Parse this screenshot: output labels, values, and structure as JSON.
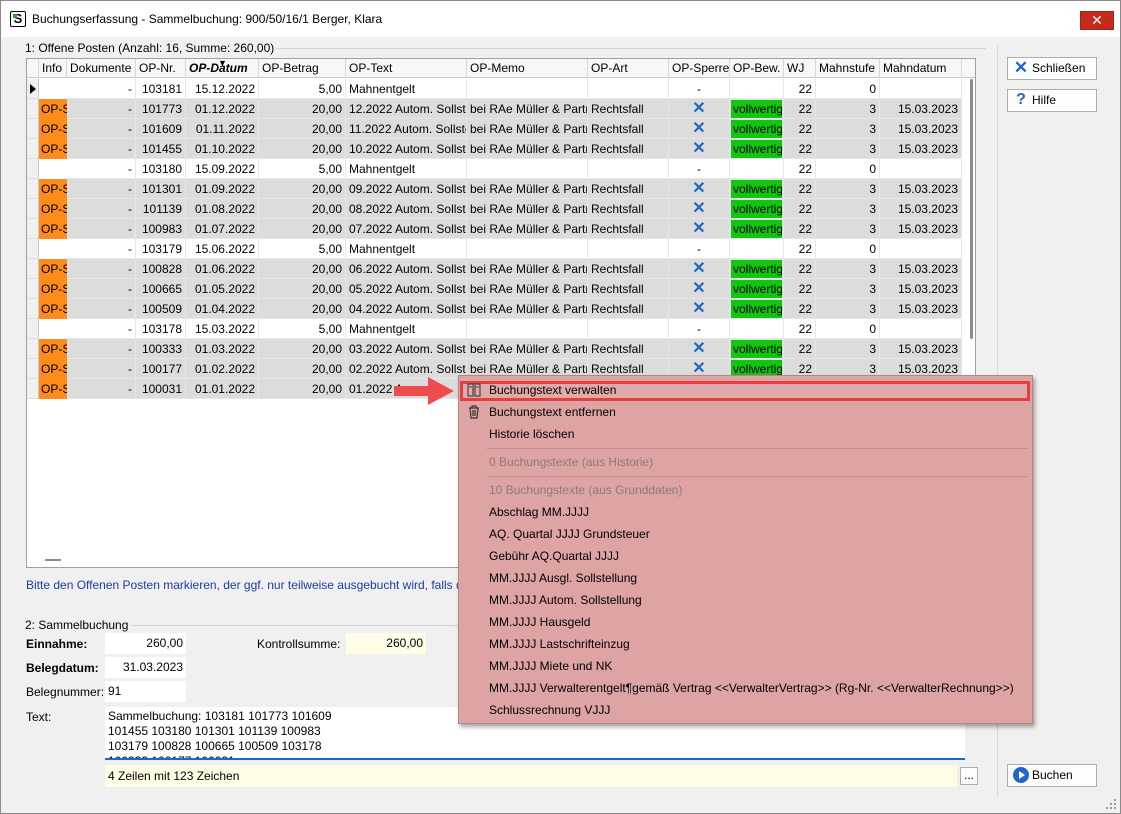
{
  "window": {
    "title": "Buchungserfassung - Sammelbuchung:  900/50/16/1 Berger, Klara",
    "close_glyph": "✕"
  },
  "section1": {
    "label": "1: Offene Posten  (Anzahl: 16,  Summe: 260,00)"
  },
  "grid": {
    "columns": [
      "Info",
      "Dokumente",
      "OP-Nr.",
      "OP-Datum",
      "OP-Betrag",
      "OP-Text",
      "OP-Memo",
      "OP-Art",
      "OP-Sperre",
      "OP-Bew.",
      "WJ",
      "Mahnstufe",
      "Mahndatum"
    ],
    "sorted_column": "OP-Datum",
    "rows": [
      {
        "info": "",
        "dok": "-",
        "nr": "103181",
        "datum": "15.12.2022",
        "betrag": "5,00",
        "text": "Mahnentgelt",
        "memo": "",
        "art": "",
        "sperre": "-",
        "bew": "",
        "wj": "22",
        "mahnstufe": "0",
        "mahndatum": ""
      },
      {
        "info": "OP-S",
        "dok": "-",
        "nr": "101773",
        "datum": "01.12.2022",
        "betrag": "20,00",
        "text": "12.2022 Autom. Sollste",
        "memo": "bei RAe Müller & Partr",
        "art": "Rechtsfall",
        "sperre": "✕",
        "bew": "vollwertig",
        "wj": "22",
        "mahnstufe": "3",
        "mahndatum": "15.03.2023"
      },
      {
        "info": "OP-S",
        "dok": "-",
        "nr": "101609",
        "datum": "01.11.2022",
        "betrag": "20,00",
        "text": "11.2022 Autom. Sollste",
        "memo": "bei RAe Müller & Partr",
        "art": "Rechtsfall",
        "sperre": "✕",
        "bew": "vollwertig",
        "wj": "22",
        "mahnstufe": "3",
        "mahndatum": "15.03.2023"
      },
      {
        "info": "OP-S",
        "dok": "-",
        "nr": "101455",
        "datum": "01.10.2022",
        "betrag": "20,00",
        "text": "10.2022 Autom. Sollste",
        "memo": "bei RAe Müller & Partr",
        "art": "Rechtsfall",
        "sperre": "✕",
        "bew": "vollwertig",
        "wj": "22",
        "mahnstufe": "3",
        "mahndatum": "15.03.2023"
      },
      {
        "info": "",
        "dok": "-",
        "nr": "103180",
        "datum": "15.09.2022",
        "betrag": "5,00",
        "text": "Mahnentgelt",
        "memo": "",
        "art": "",
        "sperre": "-",
        "bew": "",
        "wj": "22",
        "mahnstufe": "0",
        "mahndatum": ""
      },
      {
        "info": "OP-S",
        "dok": "-",
        "nr": "101301",
        "datum": "01.09.2022",
        "betrag": "20,00",
        "text": "09.2022 Autom. Sollste",
        "memo": "bei RAe Müller & Partr",
        "art": "Rechtsfall",
        "sperre": "✕",
        "bew": "vollwertig",
        "wj": "22",
        "mahnstufe": "3",
        "mahndatum": "15.03.2023"
      },
      {
        "info": "OP-S",
        "dok": "-",
        "nr": "101139",
        "datum": "01.08.2022",
        "betrag": "20,00",
        "text": "08.2022 Autom. Sollste",
        "memo": "bei RAe Müller & Partr",
        "art": "Rechtsfall",
        "sperre": "✕",
        "bew": "vollwertig",
        "wj": "22",
        "mahnstufe": "3",
        "mahndatum": "15.03.2023"
      },
      {
        "info": "OP-S",
        "dok": "-",
        "nr": "100983",
        "datum": "01.07.2022",
        "betrag": "20,00",
        "text": "07.2022 Autom. Sollste",
        "memo": "bei RAe Müller & Partr",
        "art": "Rechtsfall",
        "sperre": "✕",
        "bew": "vollwertig",
        "wj": "22",
        "mahnstufe": "3",
        "mahndatum": "15.03.2023"
      },
      {
        "info": "",
        "dok": "-",
        "nr": "103179",
        "datum": "15.06.2022",
        "betrag": "5,00",
        "text": "Mahnentgelt",
        "memo": "",
        "art": "",
        "sperre": "-",
        "bew": "",
        "wj": "22",
        "mahnstufe": "0",
        "mahndatum": ""
      },
      {
        "info": "OP-S",
        "dok": "-",
        "nr": "100828",
        "datum": "01.06.2022",
        "betrag": "20,00",
        "text": "06.2022 Autom. Sollste",
        "memo": "bei RAe Müller & Partr",
        "art": "Rechtsfall",
        "sperre": "✕",
        "bew": "vollwertig",
        "wj": "22",
        "mahnstufe": "3",
        "mahndatum": "15.03.2023"
      },
      {
        "info": "OP-S",
        "dok": "-",
        "nr": "100665",
        "datum": "01.05.2022",
        "betrag": "20,00",
        "text": "05.2022 Autom. Sollste",
        "memo": "bei RAe Müller & Partr",
        "art": "Rechtsfall",
        "sperre": "✕",
        "bew": "vollwertig",
        "wj": "22",
        "mahnstufe": "3",
        "mahndatum": "15.03.2023"
      },
      {
        "info": "OP-S",
        "dok": "-",
        "nr": "100509",
        "datum": "01.04.2022",
        "betrag": "20,00",
        "text": "04.2022 Autom. Sollste",
        "memo": "bei RAe Müller & Partr",
        "art": "Rechtsfall",
        "sperre": "✕",
        "bew": "vollwertig",
        "wj": "22",
        "mahnstufe": "3",
        "mahndatum": "15.03.2023"
      },
      {
        "info": "",
        "dok": "-",
        "nr": "103178",
        "datum": "15.03.2022",
        "betrag": "5,00",
        "text": "Mahnentgelt",
        "memo": "",
        "art": "",
        "sperre": "-",
        "bew": "",
        "wj": "22",
        "mahnstufe": "0",
        "mahndatum": ""
      },
      {
        "info": "OP-S",
        "dok": "-",
        "nr": "100333",
        "datum": "01.03.2022",
        "betrag": "20,00",
        "text": "03.2022 Autom. Sollste",
        "memo": "bei RAe Müller & Partr",
        "art": "Rechtsfall",
        "sperre": "✕",
        "bew": "vollwertig",
        "wj": "22",
        "mahnstufe": "3",
        "mahndatum": "15.03.2023"
      },
      {
        "info": "OP-S",
        "dok": "-",
        "nr": "100177",
        "datum": "01.02.2022",
        "betrag": "20,00",
        "text": "02.2022 Autom. Sollste",
        "memo": "bei RAe Müller & Partr",
        "art": "Rechtsfall",
        "sperre": "✕",
        "bew": "vollwertig",
        "wj": "22",
        "mahnstufe": "3",
        "mahndatum": "15.03.2023"
      },
      {
        "info": "OP-S",
        "dok": "-",
        "nr": "100031",
        "datum": "01.01.2022",
        "betrag": "20,00",
        "text": "01.2022 A",
        "memo": "",
        "art": "",
        "sperre": "",
        "bew": "",
        "wj": "",
        "mahnstufe": "",
        "mahndatum": ""
      }
    ]
  },
  "hint": "Bitte den Offenen Posten markieren, der ggf. nur teilweise ausgebucht wird, falls de",
  "section2": {
    "label": "2: Sammelbuchung",
    "einnahme_label": "Einnahme:",
    "einnahme_value": "260,00",
    "kontroll_label": "Kontrollsumme:",
    "kontroll_value": "260,00",
    "belegdatum_label": "Belegdatum:",
    "belegdatum_value": "31.03.2023",
    "belegnummer_label": "Belegnummer:",
    "belegnummer_value": "91",
    "text_label": "Text:",
    "text_value": "Sammelbuchung: 103181 101773 101609\n101455 103180 101301 101139 100983\n103179 100828 100665 100509 103178\n100333 100177 100031",
    "status": "4 Zeilen mit 123 Zeichen",
    "dots": "..."
  },
  "buttons": {
    "close": "Schließen",
    "help": "Hilfe",
    "book": "Buchen"
  },
  "context_menu": {
    "items": [
      {
        "label": "Buchungstext verwalten",
        "icon": "manage-icon",
        "disabled": false
      },
      {
        "label": "Buchungstext entfernen",
        "icon": "trash-icon",
        "disabled": false
      },
      {
        "label": "Historie löschen",
        "icon": "",
        "disabled": false
      },
      {
        "label": "0 Buchungstexte (aus Historie)",
        "icon": "",
        "disabled": true
      },
      {
        "label": "10 Buchungstexte (aus Grunddaten)",
        "icon": "",
        "disabled": true
      },
      {
        "label": "Abschlag MM.JJJJ",
        "icon": "",
        "disabled": false
      },
      {
        "label": "AQ. Quartal JJJJ Grundsteuer",
        "icon": "",
        "disabled": false
      },
      {
        "label": "Gebühr AQ.Quartal JJJJ",
        "icon": "",
        "disabled": false
      },
      {
        "label": "MM.JJJJ Ausgl. Sollstellung",
        "icon": "",
        "disabled": false
      },
      {
        "label": "MM.JJJJ Autom. Sollstellung",
        "icon": "",
        "disabled": false
      },
      {
        "label": "MM.JJJJ Hausgeld",
        "icon": "",
        "disabled": false
      },
      {
        "label": "MM.JJJJ Lastschrifteinzug",
        "icon": "",
        "disabled": false
      },
      {
        "label": "MM.JJJJ Miete und NK",
        "icon": "",
        "disabled": false
      },
      {
        "label": "MM.JJJJ Verwalterentgelt¶gemäß Vertrag <<VerwalterVertrag>> (Rg-Nr. <<VerwalterRechnung>>)",
        "icon": "",
        "disabled": false
      },
      {
        "label": "Schlussrechnung VJJJ",
        "icon": "",
        "disabled": false
      }
    ]
  },
  "colors": {
    "info_badge": "#ff8c1a",
    "bew_badge": "#11c611",
    "context_menu_bg": "#dea3a3",
    "highlight": "#e53e3e",
    "accent": "#1f66c9"
  }
}
